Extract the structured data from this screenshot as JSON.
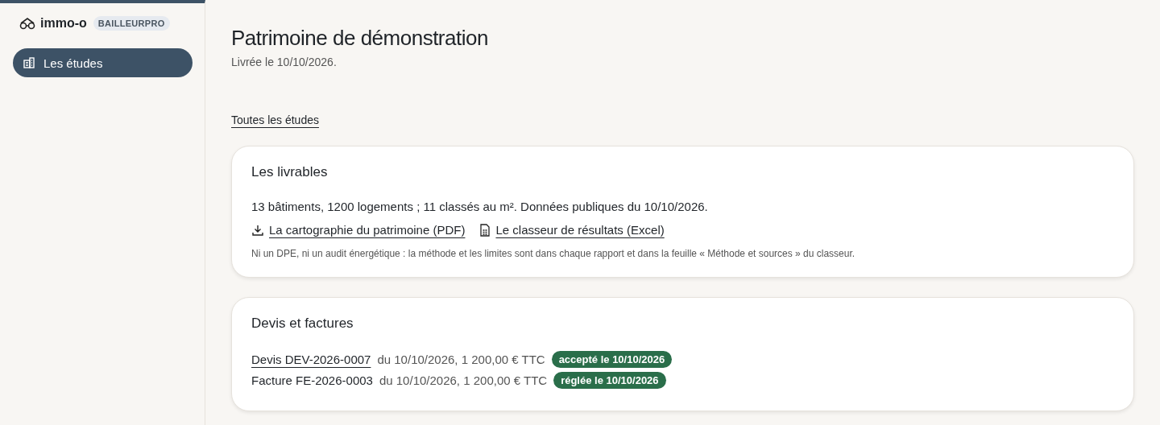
{
  "sidebar": {
    "brand": "immo-o",
    "badge": "BAILLEURPRO",
    "items": [
      {
        "label": "Les études",
        "selected": true
      }
    ]
  },
  "header": {
    "title": "Patrimoine de démonstration",
    "subtitle": "Livrée le 10/10/2026."
  },
  "back_link": "Toutes les études",
  "deliverables": {
    "title": "Les livrables",
    "summary": "13 bâtiments, 1200 logements ; 11 classés au m². Données publiques du 10/10/2026.",
    "files": [
      {
        "kind": "download",
        "label": "La cartographie du patrimoine (PDF)"
      },
      {
        "kind": "sheet",
        "label": "Le classeur de résultats (Excel)"
      }
    ],
    "note": "Ni un DPE, ni un audit énergétique : la méthode et les limites sont dans chaque rapport et dans la feuille « Méthode et sources » du classeur."
  },
  "billing": {
    "title": "Devis et factures",
    "documents": [
      {
        "kind": "link",
        "name": "Devis DEV-2026-0007",
        "details": "du 10/10/2026, 1 200,00 € TTC",
        "status": "accepté le 10/10/2026"
      },
      {
        "kind": "text",
        "name": "Facture FE-2026-0003",
        "details": "du 10/10/2026, 1 200,00 € TTC",
        "status": "réglée le 10/10/2026"
      }
    ]
  }
}
